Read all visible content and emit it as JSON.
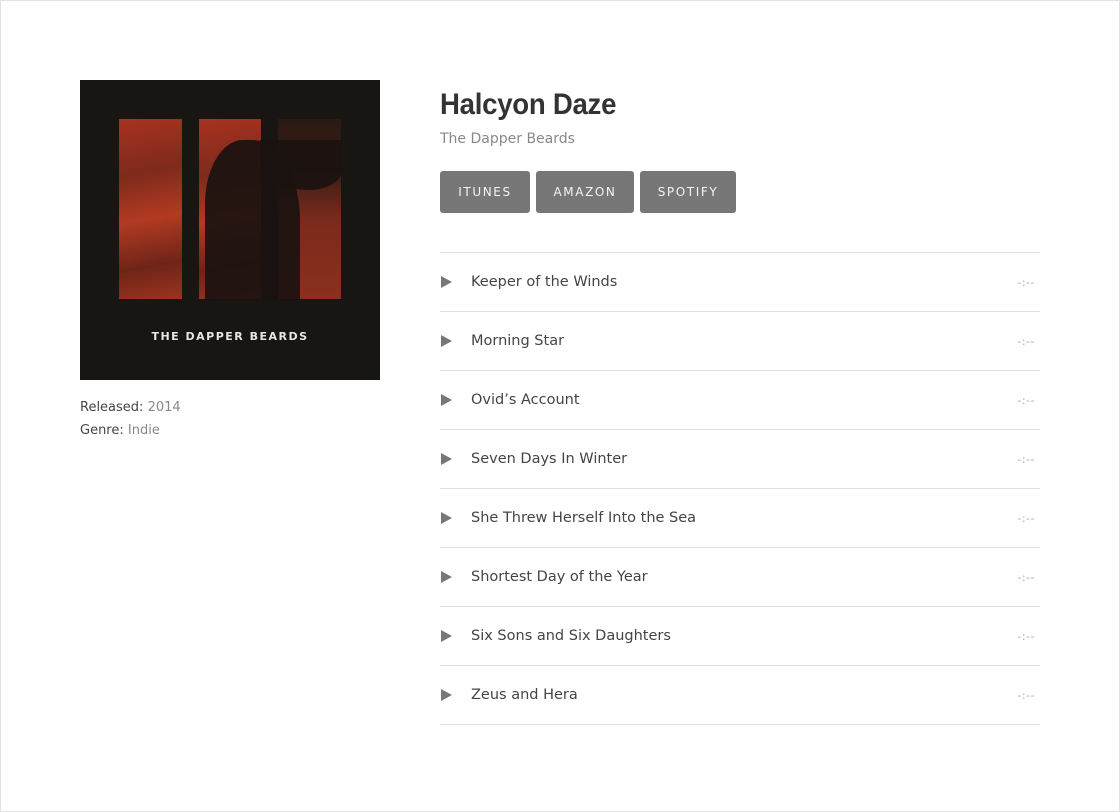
{
  "album": {
    "title": "Halcyon Daze",
    "artist": "The Dapper Beards",
    "cover_text": "THE DAPPER BEARDS",
    "released_label": "Released:",
    "released_value": "2014",
    "genre_label": "Genre:",
    "genre_value": "Indie"
  },
  "buttons": {
    "itunes": "ITUNES",
    "amazon": "AMAZON",
    "spotify": "SPOTIFY"
  },
  "tracks": [
    {
      "name": "Keeper of the Winds",
      "time": "-:--"
    },
    {
      "name": "Morning Star",
      "time": "-:--"
    },
    {
      "name": "Ovid’s Account",
      "time": "-:--"
    },
    {
      "name": "Seven Days In Winter",
      "time": "-:--"
    },
    {
      "name": "She Threw Herself Into the Sea",
      "time": "-:--"
    },
    {
      "name": "Shortest Day of the Year",
      "time": "-:--"
    },
    {
      "name": "Six Sons and Six Daughters",
      "time": "-:--"
    },
    {
      "name": "Zeus and Hera",
      "time": "-:--"
    }
  ],
  "colors": {
    "button_bg": "#777777",
    "divider": "#e0e0e0",
    "muted_text": "#888888"
  }
}
